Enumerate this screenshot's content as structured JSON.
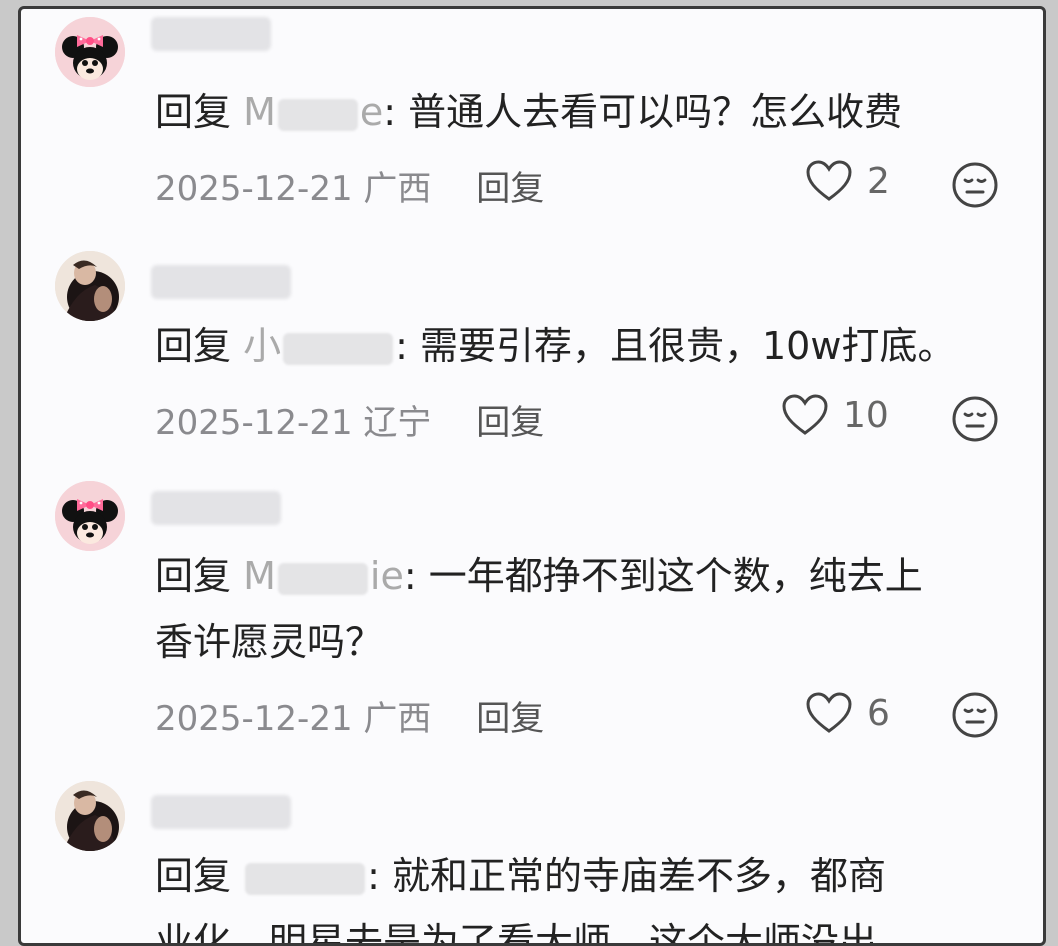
{
  "comments": [
    {
      "reply_prefix": "回复",
      "mentioned_partial_start": "M",
      "mentioned_partial_end": "e",
      "text": ": 普通人去看可以吗？怎么收费",
      "date": "2025-12-21",
      "region": "广西",
      "reply_label": "回复",
      "likes": "2",
      "avatar": "minnie-avatar"
    },
    {
      "reply_prefix": "回复",
      "mentioned_partial_start": "小",
      "mentioned_partial_end": "",
      "text": ": 需要引荐，且很贵，10w打底。",
      "date": "2025-12-21",
      "region": "辽宁",
      "reply_label": "回复",
      "likes": "10",
      "avatar": "woman-avatar"
    },
    {
      "reply_prefix": "回复",
      "mentioned_partial_start": "M",
      "mentioned_partial_end": "ie",
      "text_line1": ": 一年都挣不到这个数，纯去上",
      "text_line2": "香许愿灵吗？",
      "date": "2025-12-21",
      "region": "广西",
      "reply_label": "回复",
      "likes": "6",
      "avatar": "minnie-avatar"
    },
    {
      "reply_prefix": "回复",
      "mentioned_partial_start": "",
      "mentioned_partial_end": "",
      "text_line1": ": 就和正常的寺庙差不多，都商",
      "text_line2": "业化，明星去是为了看大师，这个大师没出",
      "avatar": "woman-avatar"
    }
  ],
  "icons": {
    "like": "heart-outline-icon",
    "reaction": "neutral-face-icon"
  },
  "colors": {
    "text": "#222222",
    "meta": "#8a8a8e",
    "background": "#fbfbfd"
  }
}
